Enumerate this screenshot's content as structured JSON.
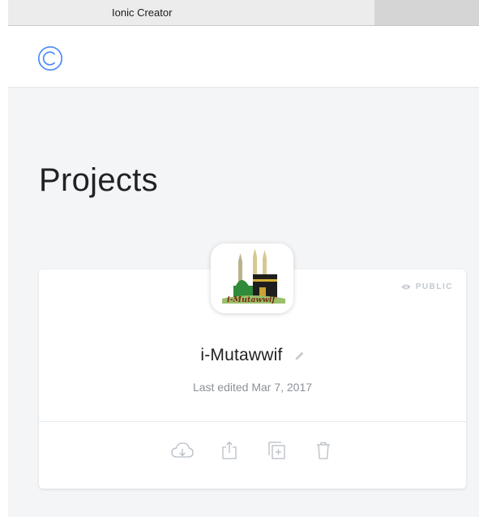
{
  "window": {
    "title": "Ionic Creator"
  },
  "header": {
    "logo_icon": "ionic-logo-icon",
    "brand_color": "#4a8bfc"
  },
  "main": {
    "page_title": "Projects",
    "projects": [
      {
        "name": "i-Mutawwif",
        "logo_text": "i-Mutawwif",
        "visibility": "PUBLIC",
        "last_edited": "Last edited Mar 7, 2017",
        "actions": [
          {
            "icon": "cloud-download-icon"
          },
          {
            "icon": "share-icon"
          },
          {
            "icon": "duplicate-icon"
          },
          {
            "icon": "trash-icon"
          }
        ]
      }
    ]
  }
}
